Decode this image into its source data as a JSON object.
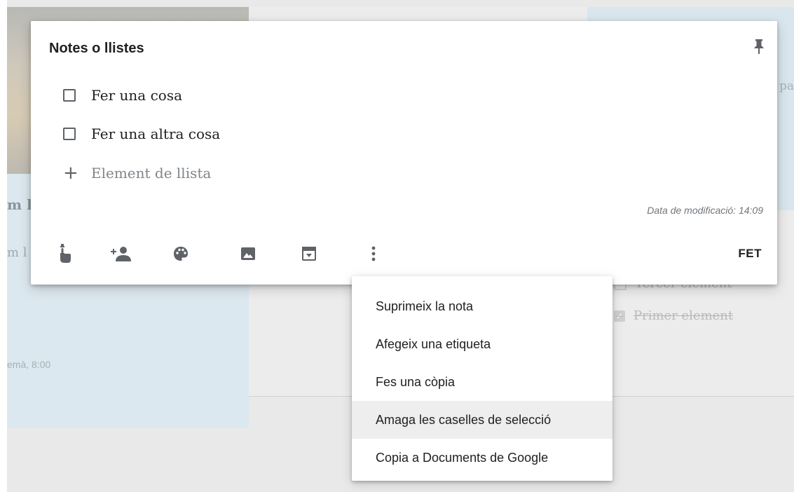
{
  "background": {
    "left_card_title": "m l",
    "left_card_text": "m l",
    "left_card_time": "emà, 8:00",
    "right_card_snippet": "pa",
    "right_list": [
      {
        "label": "Tercer element"
      },
      {
        "label": "Primer element"
      }
    ]
  },
  "note": {
    "title": "Notes o llistes",
    "items": [
      {
        "label": "Fer una cosa",
        "checked": false
      },
      {
        "label": "Fer una altra cosa",
        "checked": false
      }
    ],
    "add_item_placeholder": "Element de llista",
    "modified": "Data de modificació: 14:09",
    "done_label": "FET",
    "icons": {
      "pin": "pin-icon",
      "reminder": "reminder-hand-icon",
      "collaborator": "add-person-icon",
      "color": "palette-icon",
      "image": "image-icon",
      "archive": "archive-icon",
      "more": "more-vertical-icon"
    }
  },
  "menu": {
    "items": [
      {
        "label": "Suprimeix la nota"
      },
      {
        "label": "Afegeix una etiqueta"
      },
      {
        "label": "Fes una còpia"
      },
      {
        "label": "Amaga les caselles de selecció",
        "highlighted": true
      },
      {
        "label": "Copia a Documents de Google"
      }
    ]
  },
  "colors": {
    "icon": "#5f6368",
    "text": "#202124",
    "menu_hover": "#eeeeee",
    "card_blue": "#dce8ef"
  }
}
